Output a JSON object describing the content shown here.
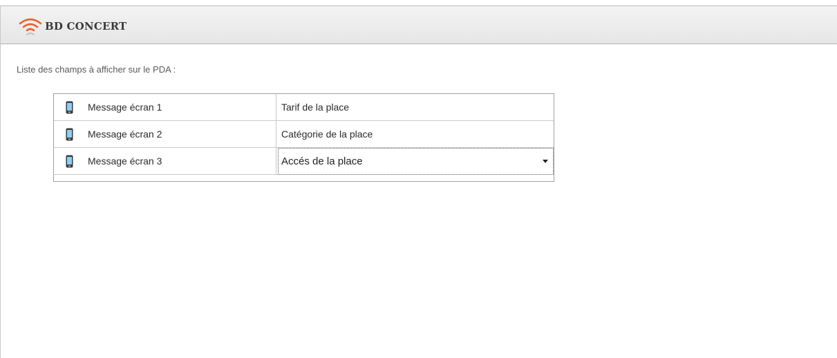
{
  "header": {
    "title": "BD CONCERT",
    "icon": "wifi-signal-icon",
    "accent_color": "#e8632c"
  },
  "panel": {
    "intro_label": "Liste des champs à afficher sur le PDA :"
  },
  "grid": {
    "rows": [
      {
        "icon": "mobile-phone-icon",
        "label": "Message écran 1",
        "value": "Tarif de la place"
      },
      {
        "icon": "mobile-phone-icon",
        "label": "Message écran 2",
        "value": "Catégorie de la place"
      },
      {
        "icon": "mobile-phone-icon",
        "label": "Message écran 3",
        "value": "Accés de la place"
      }
    ],
    "editing_row_index": 2
  }
}
